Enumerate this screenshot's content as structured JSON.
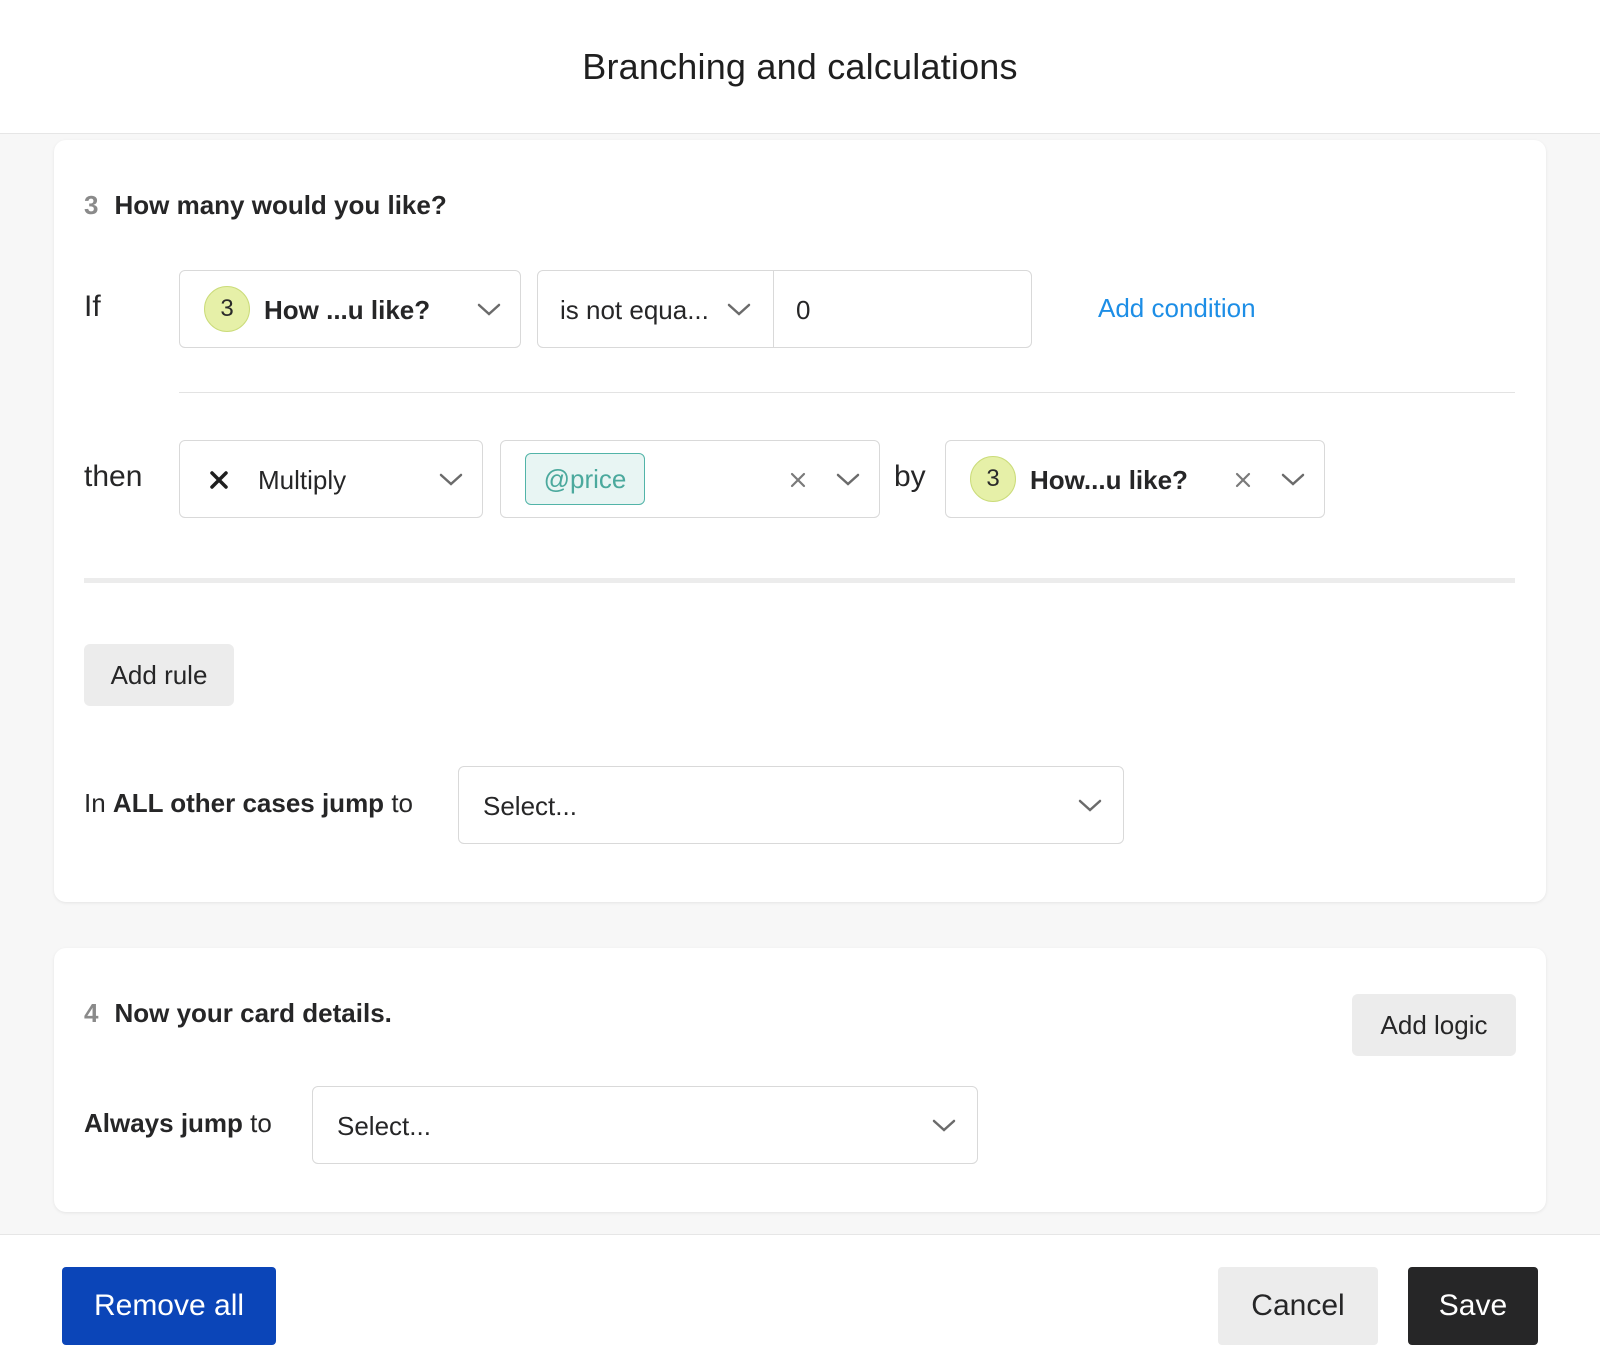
{
  "header": {
    "title": "Branching and calculations"
  },
  "question3": {
    "number": "3",
    "title": "How many would you like?",
    "if_label": "If",
    "condition": {
      "field_badge": "3",
      "field_label": "How ...u like?",
      "operator": "is not equa...",
      "value": "0",
      "add_condition": "Add condition"
    },
    "then_label": "then",
    "action": {
      "operation_icon": "multiply-icon",
      "operation": "Multiply",
      "variable_tag": "@price",
      "by_label": "by",
      "operand_badge": "3",
      "operand_label": "How...u like?"
    },
    "add_rule": "Add rule",
    "fallback": {
      "prefix": "In",
      "bold": "ALL other cases jump",
      "suffix": "to",
      "select_placeholder": "Select..."
    }
  },
  "question4": {
    "number": "4",
    "title": "Now your card details.",
    "add_logic": "Add logic",
    "always": {
      "bold": "Always jump",
      "suffix": "to",
      "select_placeholder": "Select..."
    }
  },
  "footer": {
    "remove_all": "Remove all",
    "cancel": "Cancel",
    "save": "Save"
  },
  "colors": {
    "primary": "#0b45b8",
    "dark": "#262627",
    "link": "#1d8ee6",
    "tag_border": "#52b4a8",
    "badge_fill": "#e6f0a8"
  }
}
